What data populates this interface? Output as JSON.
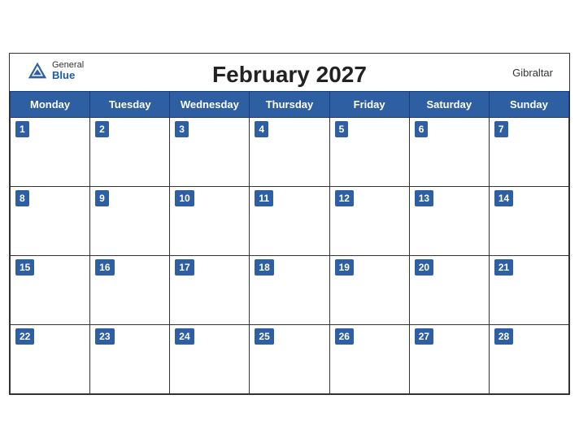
{
  "header": {
    "title": "February 2027",
    "region": "Gibraltar",
    "brand_general": "General",
    "brand_blue": "Blue"
  },
  "weekdays": [
    "Monday",
    "Tuesday",
    "Wednesday",
    "Thursday",
    "Friday",
    "Saturday",
    "Sunday"
  ],
  "weeks": [
    [
      1,
      2,
      3,
      4,
      5,
      6,
      7
    ],
    [
      8,
      9,
      10,
      11,
      12,
      13,
      14
    ],
    [
      15,
      16,
      17,
      18,
      19,
      20,
      21
    ],
    [
      22,
      23,
      24,
      25,
      26,
      27,
      28
    ]
  ]
}
